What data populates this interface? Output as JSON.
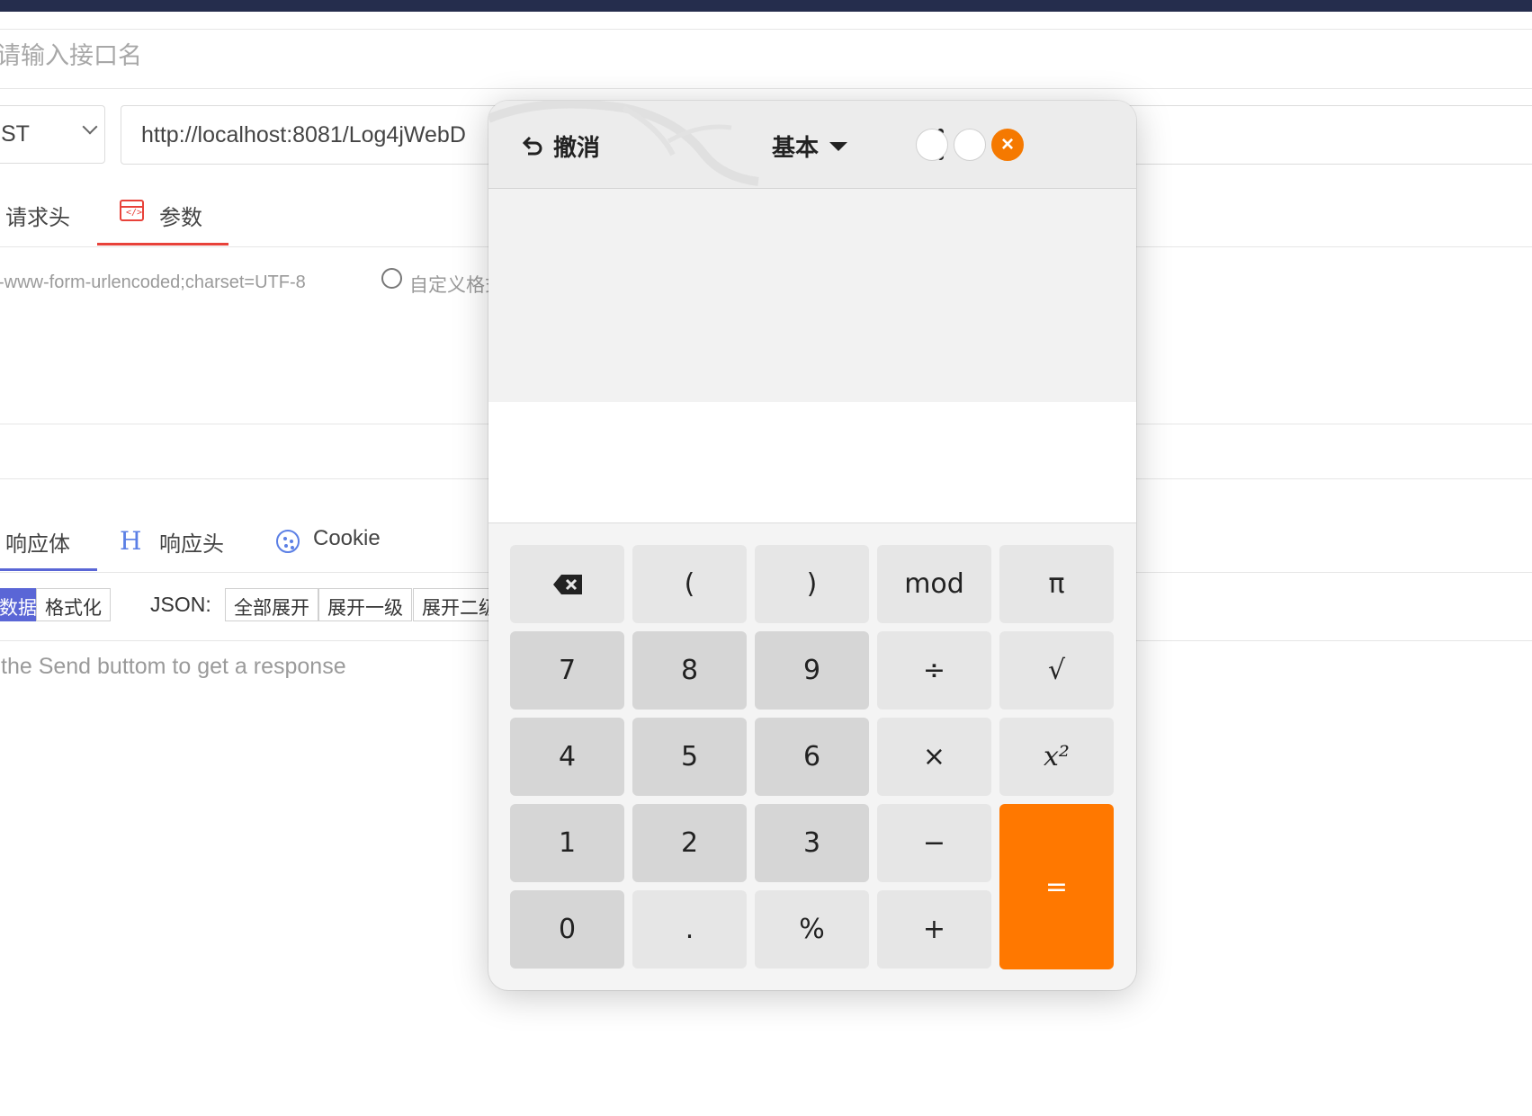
{
  "api_tool": {
    "name_placeholder": "请输入接口名",
    "method": "ST",
    "url": "http://localhost:8081/Log4jWebD",
    "request_tabs": [
      "请求头",
      "参数"
    ],
    "content_type": "-www-form-urlencoded;charset=UTF-8",
    "custom_format": "自定义格式",
    "response_tabs": [
      "响应体",
      "响应头",
      "Cookie"
    ],
    "view_modes": [
      "数据",
      "格式化"
    ],
    "json_label": "JSON:",
    "json_actions": [
      "全部展开",
      "展开一级",
      "展开二级"
    ],
    "hint": "the Send buttom to get a response",
    "colors": {
      "topbar": "#252d4d",
      "accent_red": "#e8423a",
      "accent_blue": "#5b7fe5",
      "active_segment": "#5a66d6"
    }
  },
  "calculator": {
    "undo_label": "撤消",
    "mode_label": "基本",
    "close_symbol": "×",
    "icons": [
      "undo-icon",
      "caret-down-icon",
      "kebab-menu-icon",
      "backspace-icon"
    ],
    "keys": [
      [
        "⌫",
        "(",
        ")",
        "mod",
        "π"
      ],
      [
        "7",
        "8",
        "9",
        "÷",
        "√"
      ],
      [
        "4",
        "5",
        "6",
        "×",
        "x²"
      ],
      [
        "1",
        "2",
        "3",
        "−",
        "="
      ],
      [
        "0",
        ".",
        "%",
        "+"
      ]
    ],
    "colors": {
      "equals": "#ff7800",
      "close_button": "#f57900"
    }
  }
}
